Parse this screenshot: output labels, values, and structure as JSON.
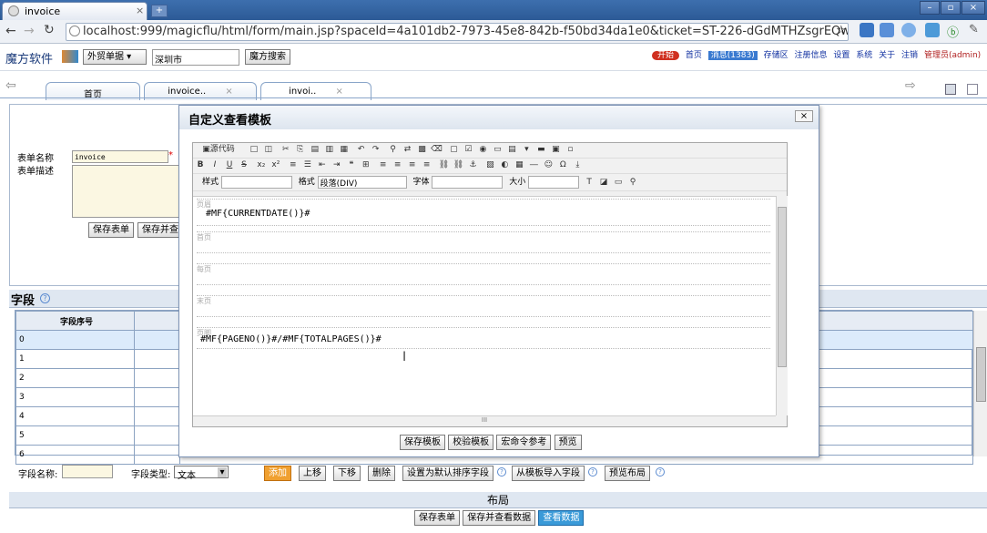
{
  "browser": {
    "tab_title": "invoice",
    "url": "localhost:999/magicflu/html/form/main.jsp?spaceId=4a101db2-7973-45e8-842b-f50bd34da1e0&ticket=ST-226-dGdMTHZsgrEQwrB0a97S-ww"
  },
  "brand": {
    "name": "魔方软件",
    "dropdown": "外贸单据",
    "search_value": "深圳市",
    "search_button": "魔方搜索"
  },
  "topnav": {
    "start": "开始",
    "home": "首页",
    "messages": "消息(1383)",
    "storage": "存储区",
    "register": "注册信息",
    "settings": "设置",
    "system": "系统",
    "about": "关于",
    "logout": "注销",
    "admin": "管理员(admin)"
  },
  "pagetabs": [
    {
      "label": "首页"
    },
    {
      "label": "invoice.."
    },
    {
      "label": "invoi.."
    }
  ],
  "form": {
    "name_label": "表单名称",
    "name_value": "invoice",
    "desc_label": "表单描述",
    "save_form": "保存表单",
    "save_view": "保存并查看"
  },
  "fields": {
    "title": "字段",
    "col_header": "字段序号",
    "rows": [
      "0",
      "1",
      "2",
      "3",
      "4",
      "5",
      "6"
    ]
  },
  "fieldbar": {
    "name_label": "字段名称:",
    "type_label": "字段类型:",
    "type_value": "文本",
    "add": "添加",
    "up": "上移",
    "down": "下移",
    "delete": "删除",
    "set_default": "设置为默认排序字段",
    "import": "从模板导入字段",
    "preview_layout": "预览布局"
  },
  "layout": {
    "title": "布局",
    "save_form": "保存表单",
    "save_view": "保存并查看数据",
    "view_data": "查看数据"
  },
  "dialog": {
    "title": "自定义查看模板",
    "close": "×",
    "toolbar": {
      "source": "源代码",
      "style_label": "样式",
      "format_label": "格式",
      "format_value": "段落(DIV)",
      "font_label": "字体",
      "size_label": "大小"
    },
    "sections": [
      {
        "label": "页眉",
        "code": "#MF{CURRENTDATE()}#"
      },
      {
        "label": "首页",
        "code": ""
      },
      {
        "label": "每页",
        "code": ""
      },
      {
        "label": "末页",
        "code": ""
      },
      {
        "label": "页脚",
        "code": "#MF{PAGENO()}#/#MF{TOTALPAGES()}#"
      }
    ],
    "buttons": {
      "save": "保存模板",
      "verify": "校验模板",
      "macro": "宏命令参考",
      "preview": "预览"
    },
    "hscroll_mark": "III"
  }
}
